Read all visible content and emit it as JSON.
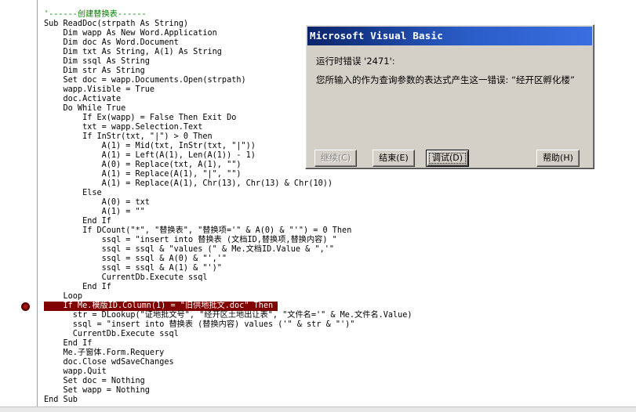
{
  "editor": {
    "lines": [
      "'------创建替换表------",
      "Sub ReadDoc(strpath As String)",
      "    Dim wapp As New Word.Application",
      "    Dim doc As Word.Document",
      "    Dim txt As String, A(1) As String",
      "    Dim ssql As String",
      "    Dim str As String",
      "    Set doc = wapp.Documents.Open(strpath)",
      "    wapp.Visible = True",
      "    doc.Activate",
      "    Do While True",
      "        If Ex(wapp) = False Then Exit Do",
      "        txt = wapp.Selection.Text",
      "        If InStr(txt, \"|\") > 0 Then",
      "            A(1) = Mid(txt, InStr(txt, \"|\"))",
      "            A(1) = Left(A(1), Len(A(1)) - 1)",
      "            A(0) = Replace(txt, A(1), \"\")",
      "            A(1) = Replace(A(1), \"|\", \"\")",
      "            A(1) = Replace(A(1), Chr(13), Chr(13) & Chr(10))",
      "        Else",
      "            A(0) = txt",
      "            A(1) = \"\"",
      "        End If",
      "        If DCount(\"*\", \"替换表\", \"替换项='\" & A(0) & \"'\") = 0 Then",
      "            ssql = \"insert into 替换表 (文档ID,替换项,替换内容) \"",
      "            ssql = ssql & \"values (\" & Me.文档ID.Value & \",'\"",
      "            ssql = ssql & A(0) & \"','\"",
      "            ssql = ssql & A(1) & \"')\"",
      "            CurrentDb.Execute ssql",
      "        End If",
      "    Loop",
      "    If Me.模版ID.Column(1) = \"旧供地批文.doc\" Then",
      "      str = DLookup(\"证地批文号\", \"经开区土地出让表\", \"文件名='\" & Me.文件名.Value)",
      "      ssql = \"insert into 替换表 (替换内容) values ('\" & str & \"')\"",
      "      CurrentDb.Execute ssql",
      "    End If",
      "    Me.子窗体.Form.Requery",
      "    doc.Close wdSaveChanges",
      "    wapp.Quit",
      "    Set doc = Nothing",
      "    Set wapp = Nothing",
      "End Sub"
    ],
    "highlight_line_index": 31,
    "colors": {
      "comment": "#008000",
      "highlight_bg": "#800000",
      "highlight_fg": "#ffffff"
    }
  },
  "dialog": {
    "title": "Microsoft Visual Basic",
    "error_title": "运行时错误 '2471':",
    "error_message": "您所输入的作为查询参数的表达式产生这一错误: “经开区孵化楼”",
    "buttons": {
      "continue": "继续(C)",
      "end": "结束(E)",
      "debug": "调试(D)",
      "help": "帮助(H)"
    }
  }
}
